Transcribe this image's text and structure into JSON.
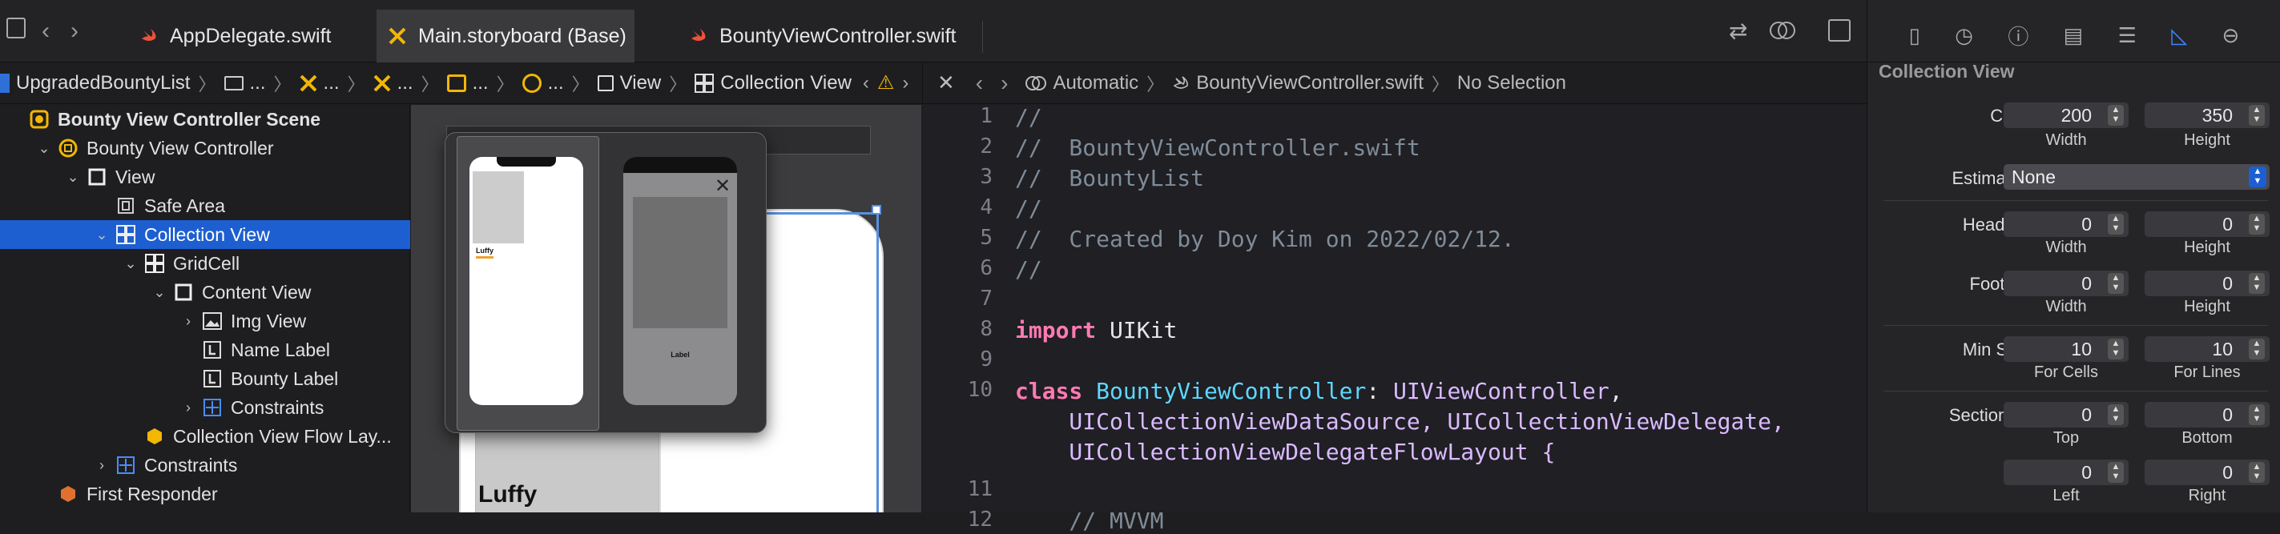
{
  "tabs": [
    {
      "label": "AppDelegate.swift",
      "active": false
    },
    {
      "label": "Main.storyboard (Base)",
      "active": true
    },
    {
      "label": "BountyViewController.swift",
      "active": false
    }
  ],
  "storyboard_jumpbar": [
    "UpgradedBountyList",
    "...",
    "...",
    "...",
    "...",
    "...",
    "View",
    "Collection View"
  ],
  "editor_jumpbar": {
    "mode": "Automatic",
    "file": "BountyViewController.swift",
    "selection": "No Selection"
  },
  "outline": [
    {
      "label": "Bounty View Controller Scene",
      "indent": 0,
      "disclosure": "",
      "icon": "scene-icon",
      "selected": false,
      "bold": true
    },
    {
      "label": "Bounty View Controller",
      "indent": 1,
      "disclosure": "down",
      "icon": "view-controller-icon",
      "selected": false
    },
    {
      "label": "View",
      "indent": 2,
      "disclosure": "down",
      "icon": "view-icon",
      "selected": false
    },
    {
      "label": "Safe Area",
      "indent": 3,
      "disclosure": "",
      "icon": "safe-area-icon",
      "selected": false
    },
    {
      "label": "Collection View",
      "indent": 3,
      "disclosure": "down",
      "icon": "grid-icon",
      "selected": true
    },
    {
      "label": "GridCell",
      "indent": 4,
      "disclosure": "down",
      "icon": "grid-icon",
      "selected": false
    },
    {
      "label": "Content View",
      "indent": 5,
      "disclosure": "down",
      "icon": "view-icon",
      "selected": false
    },
    {
      "label": "Img View",
      "indent": 6,
      "disclosure": "right",
      "icon": "image-icon",
      "selected": false
    },
    {
      "label": "Name Label",
      "indent": 6,
      "disclosure": "",
      "icon": "label-icon",
      "selected": false
    },
    {
      "label": "Bounty Label",
      "indent": 6,
      "disclosure": "",
      "icon": "label-icon",
      "selected": false
    },
    {
      "label": "Constraints",
      "indent": 6,
      "disclosure": "right",
      "icon": "constraints-icon",
      "selected": false
    },
    {
      "label": "Collection View Flow Lay...",
      "indent": 4,
      "disclosure": "",
      "icon": "cube-icon",
      "selected": false
    },
    {
      "label": "Constraints",
      "indent": 3,
      "disclosure": "right",
      "icon": "constraints-icon",
      "selected": false
    },
    {
      "label": "First Responder",
      "indent": 1,
      "disclosure": "",
      "icon": "responder-icon",
      "selected": false
    }
  ],
  "canvas": {
    "cell_name": "Luffy",
    "popover": {
      "thumb1_name": "Luffy",
      "thumb2_label": "Label"
    }
  },
  "code_lines": [
    {
      "n": "1",
      "t": "//"
    },
    {
      "n": "2",
      "t": "//  BountyViewController.swift"
    },
    {
      "n": "3",
      "t": "//  BountyList"
    },
    {
      "n": "4",
      "t": "//"
    },
    {
      "n": "5",
      "t": "//  Created by Doy Kim on 2022/02/12."
    },
    {
      "n": "6",
      "t": "//"
    },
    {
      "n": "7",
      "t": ""
    },
    {
      "n": "8",
      "kw": "import",
      "rest": " UIKit"
    },
    {
      "n": "9",
      "t": ""
    },
    {
      "n": "10",
      "kw": "class",
      "cls": " BountyViewController",
      "rest1": ": ",
      "ty1": "UIViewController",
      "rest2": ","
    },
    {
      "n": "",
      "t2": "    UICollectionViewDataSource, UICollectionViewDelegate,"
    },
    {
      "n": "",
      "t2": "    UICollectionViewDelegateFlowLayout {"
    },
    {
      "n": "11",
      "t": ""
    },
    {
      "n": "12",
      "t": "    // MVVM"
    }
  ],
  "inspector": {
    "title": "Collection View",
    "cell_size": {
      "label": "Cell Size",
      "width": "200",
      "height": "350"
    },
    "estimate_size": {
      "label": "Estimate Size",
      "value": "None"
    },
    "header_size": {
      "label": "Header Size",
      "width": "0",
      "height": "0"
    },
    "footer_size": {
      "label": "Footer Size",
      "width": "0",
      "height": "0"
    },
    "min_spacing": {
      "label": "Min Spacing",
      "cells": "10",
      "lines": "10"
    },
    "section_insets": {
      "label": "Section Insets",
      "top": "0",
      "bottom": "0",
      "left": "0",
      "right": "0"
    },
    "sub_width": "Width",
    "sub_height": "Height",
    "sub_cells": "For Cells",
    "sub_lines": "For Lines",
    "sub_top": "Top",
    "sub_bottom": "Bottom",
    "sub_left": "Left",
    "sub_right": "Right"
  },
  "colors": {
    "accent": "#1d5fd1",
    "swift": "#f05138"
  }
}
